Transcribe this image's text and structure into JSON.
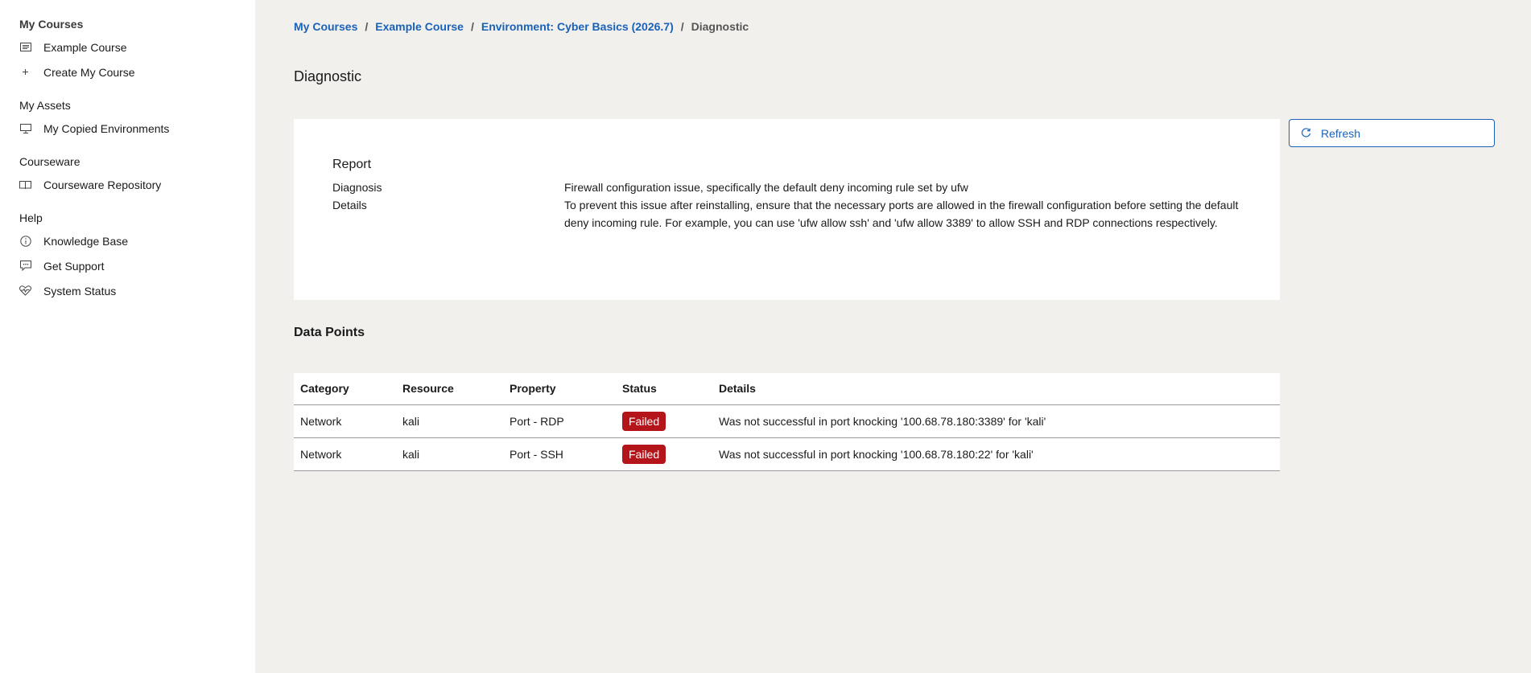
{
  "sidebar": {
    "sections": [
      {
        "heading": "My Courses",
        "items": [
          {
            "label": "Example Course",
            "icon": "list-icon"
          },
          {
            "label": "Create My Course",
            "icon": "plus-icon"
          }
        ]
      },
      {
        "heading": "My Assets",
        "items": [
          {
            "label": "My Copied Environments",
            "icon": "monitor-icon"
          }
        ]
      },
      {
        "heading": "Courseware",
        "items": [
          {
            "label": "Courseware Repository",
            "icon": "book-icon"
          }
        ]
      },
      {
        "heading": "Help",
        "items": [
          {
            "label": "Knowledge Base",
            "icon": "info-icon"
          },
          {
            "label": "Get Support",
            "icon": "chat-icon"
          },
          {
            "label": "System Status",
            "icon": "heart-pulse-icon"
          }
        ]
      }
    ]
  },
  "breadcrumb": {
    "items": [
      "My Courses",
      "Example Course",
      "Environment: Cyber Basics (2026.7)"
    ],
    "current": "Diagnostic",
    "separator": "/"
  },
  "page": {
    "title": "Diagnostic"
  },
  "refresh": {
    "label": "Refresh"
  },
  "report": {
    "title": "Report",
    "diagnosis_label": "Diagnosis",
    "diagnosis_value": "Firewall configuration issue, specifically the default deny incoming rule set by ufw",
    "details_label": "Details",
    "details_value": "To prevent this issue after reinstalling, ensure that the necessary ports are allowed in the firewall configuration before setting the default deny incoming rule. For example, you can use 'ufw allow ssh' and 'ufw allow 3389' to allow SSH and RDP connections respectively."
  },
  "data_points": {
    "title": "Data Points",
    "columns": [
      "Category",
      "Resource",
      "Property",
      "Status",
      "Details"
    ],
    "rows": [
      {
        "category": "Network",
        "resource": "kali",
        "property": "Port - RDP",
        "status": "Failed",
        "details": "Was not successful in port knocking '100.68.78.180:3389' for 'kali'"
      },
      {
        "category": "Network",
        "resource": "kali",
        "property": "Port - SSH",
        "status": "Failed",
        "details": "Was not successful in port knocking '100.68.78.180:22' for 'kali'"
      }
    ]
  },
  "colors": {
    "accent": "#1a62b8",
    "failed": "#b3151b",
    "main_bg": "#f1f0ed"
  }
}
